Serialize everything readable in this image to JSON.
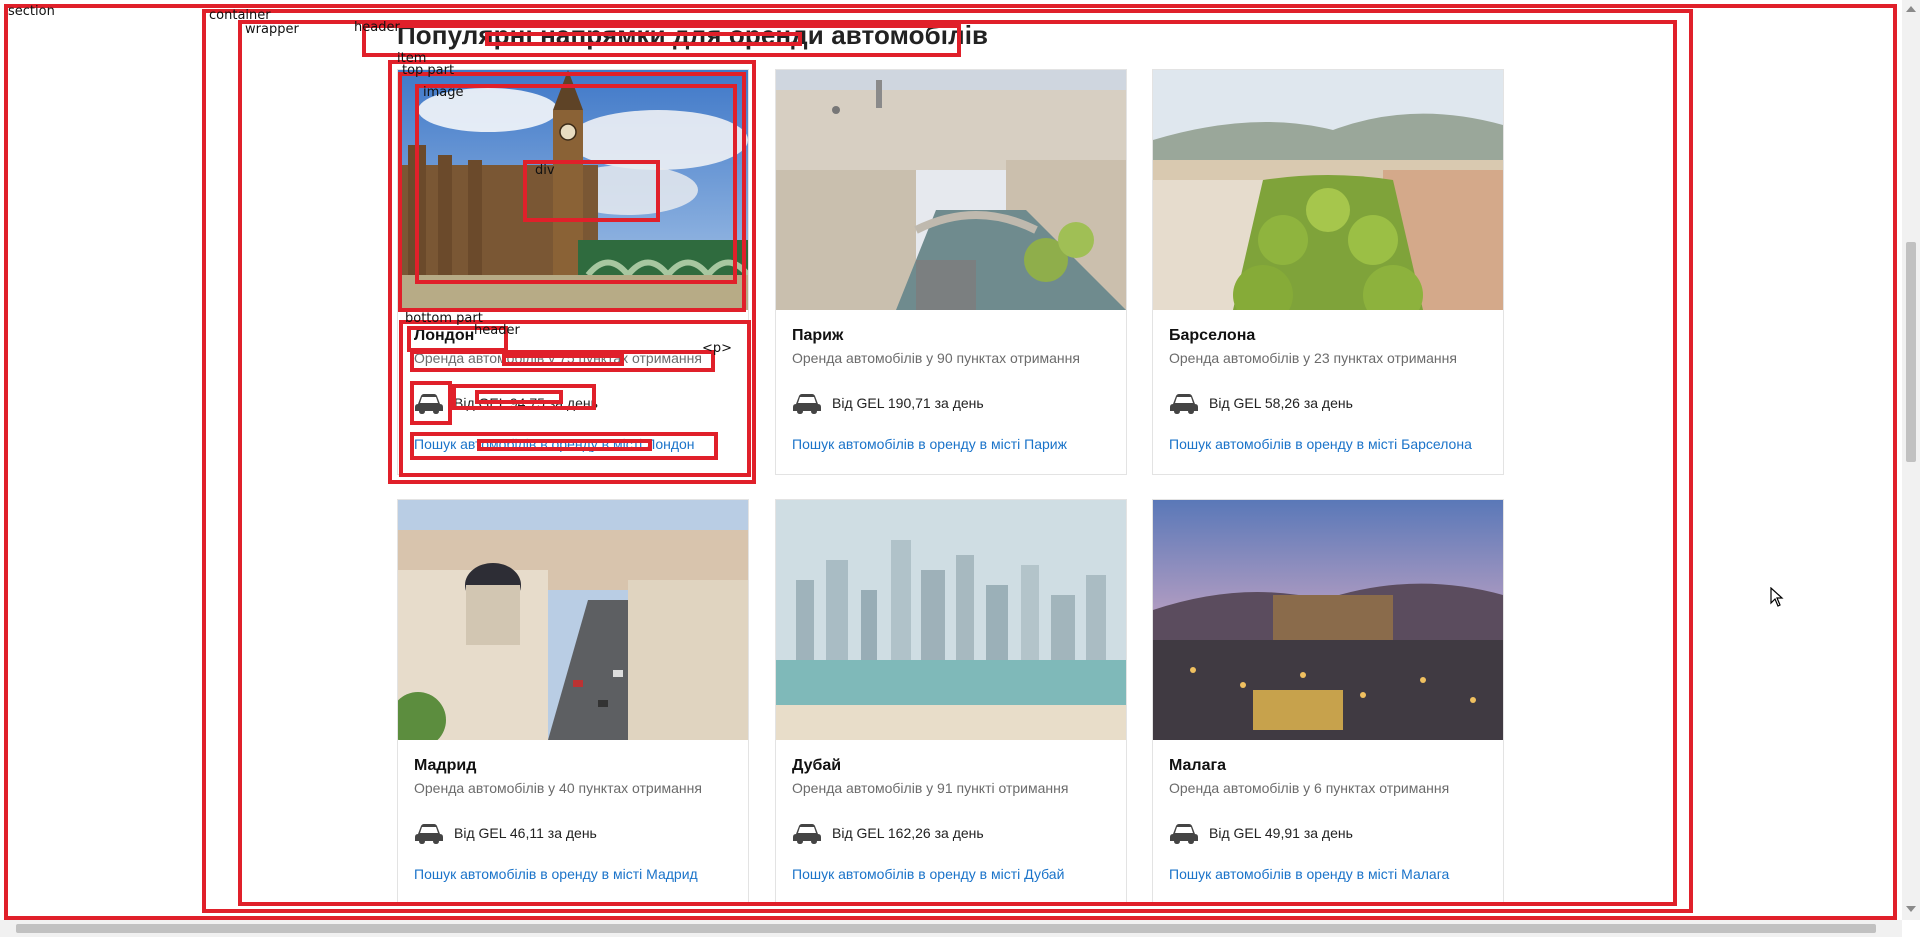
{
  "debug_labels": {
    "section": "section",
    "container": "container",
    "wrapper": "wrapper",
    "header_top": "header",
    "item": "item",
    "top_part": "top part",
    "image": "image",
    "div": "div",
    "bottom_part": "bottom part",
    "header_card": "header",
    "p": "<p>"
  },
  "page": {
    "title": "Популярні напрямки для оренди автомобілів"
  },
  "cards": [
    {
      "city": "Лондон",
      "subtitle": "Оренда автомобілів у 75 пунктах отримання",
      "price": "Від GEL 94,75 за день",
      "link": "Пошук автомобілів в оренду в місті Лондон",
      "image_icon": "london-photo"
    },
    {
      "city": "Париж",
      "subtitle": "Оренда автомобілів у 90 пунктах отримання",
      "price": "Від GEL 190,71 за день",
      "link": "Пошук автомобілів в оренду в місті Париж",
      "image_icon": "paris-photo"
    },
    {
      "city": "Барселона",
      "subtitle": "Оренда автомобілів у 23 пунктах отримання",
      "price": "Від GEL 58,26 за день",
      "link": "Пошук автомобілів в оренду в місті Барселона",
      "image_icon": "barcelona-photo"
    },
    {
      "city": "Мадрид",
      "subtitle": "Оренда автомобілів у 40 пунктах отримання",
      "price": "Від GEL 46,11 за день",
      "link": "Пошук автомобілів в оренду в місті Мадрид",
      "image_icon": "madrid-photo"
    },
    {
      "city": "Дубай",
      "subtitle": "Оренда автомобілів у 91 пункті отримання",
      "price": "Від GEL 162,26 за день",
      "link": "Пошук автомобілів в оренду в місті Дубай",
      "image_icon": "dubai-photo"
    },
    {
      "city": "Малага",
      "subtitle": "Оренда автомобілів у 6 пунктах отримання",
      "price": "Від GEL 49,91 за день",
      "link": "Пошук автомобілів в оренду в місті Малага",
      "image_icon": "malaga-photo"
    }
  ],
  "colors": {
    "debug_outline": "#e0202a",
    "link": "#1a73c9",
    "subtitle": "#6b6b6b"
  }
}
